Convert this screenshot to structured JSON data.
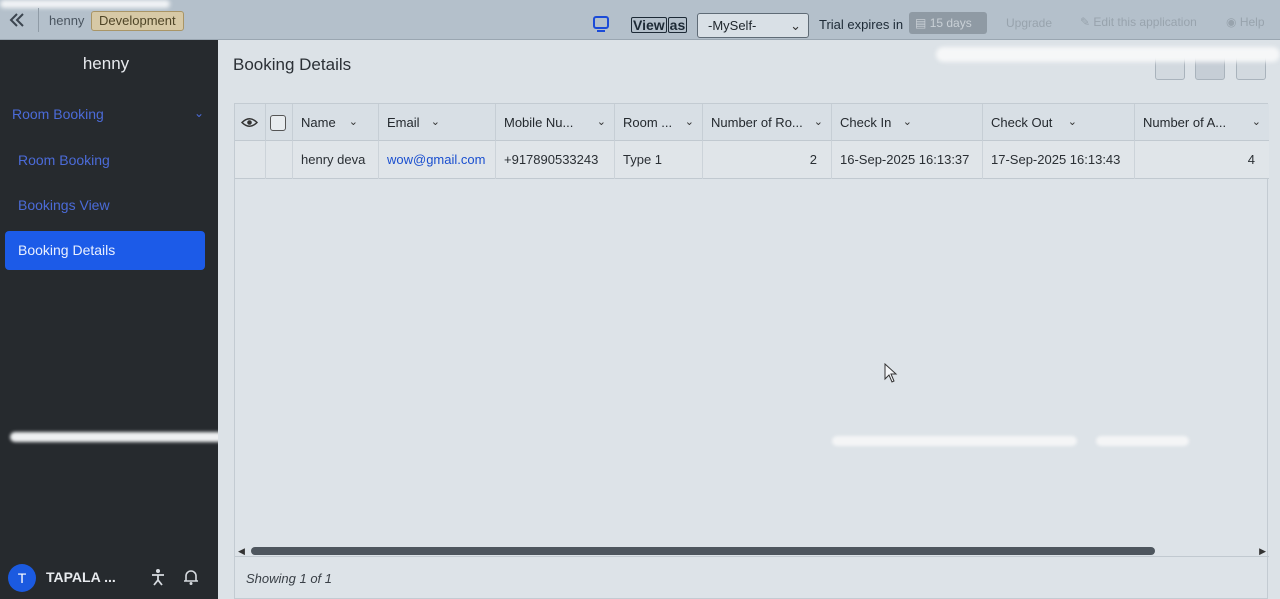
{
  "topbar": {
    "app_name": "henny",
    "environment": "Development",
    "view_as_parts": [
      "View",
      "as"
    ],
    "view_as_selected": "-MySelf-",
    "trial_label": "Trial expires in",
    "trial_days": "15 days",
    "upgrade": "Upgrade",
    "edit_app": "Edit this application",
    "help": "Help"
  },
  "sidebar": {
    "title": "henny",
    "group_label": "Room Booking",
    "items": [
      {
        "label": "Room Booking"
      },
      {
        "label": "Bookings View"
      },
      {
        "label": "Booking Details"
      }
    ],
    "user_initial": "T",
    "user_name": "TAPALA ..."
  },
  "main": {
    "page_title": "Booking Details",
    "columns": [
      "Name",
      "Email",
      "Mobile Nu...",
      "Room ...",
      "Number of Ro...",
      "Check In",
      "Check Out",
      "Number of A..."
    ],
    "rows": [
      {
        "name": "henry deva",
        "email": "wow@gmail.com",
        "mobile": "+917890533243",
        "room": "Type 1",
        "rooms": "2",
        "check_in": "16-Sep-2025 16:13:37",
        "check_out": "17-Sep-2025 16:13:43",
        "adults": "4"
      }
    ],
    "showing": "Showing 1 of 1"
  },
  "colors": {
    "accent": "#1c5be8",
    "sidebar_bg": "#262a2e",
    "link": "#1a4fcf"
  },
  "icons": [
    "back-icon",
    "device-icon",
    "calendar-icon",
    "pencil-icon",
    "help-icon",
    "eye-icon",
    "chevron-down-icon",
    "accessibility-icon",
    "bell-icon",
    "cursor-icon"
  ]
}
